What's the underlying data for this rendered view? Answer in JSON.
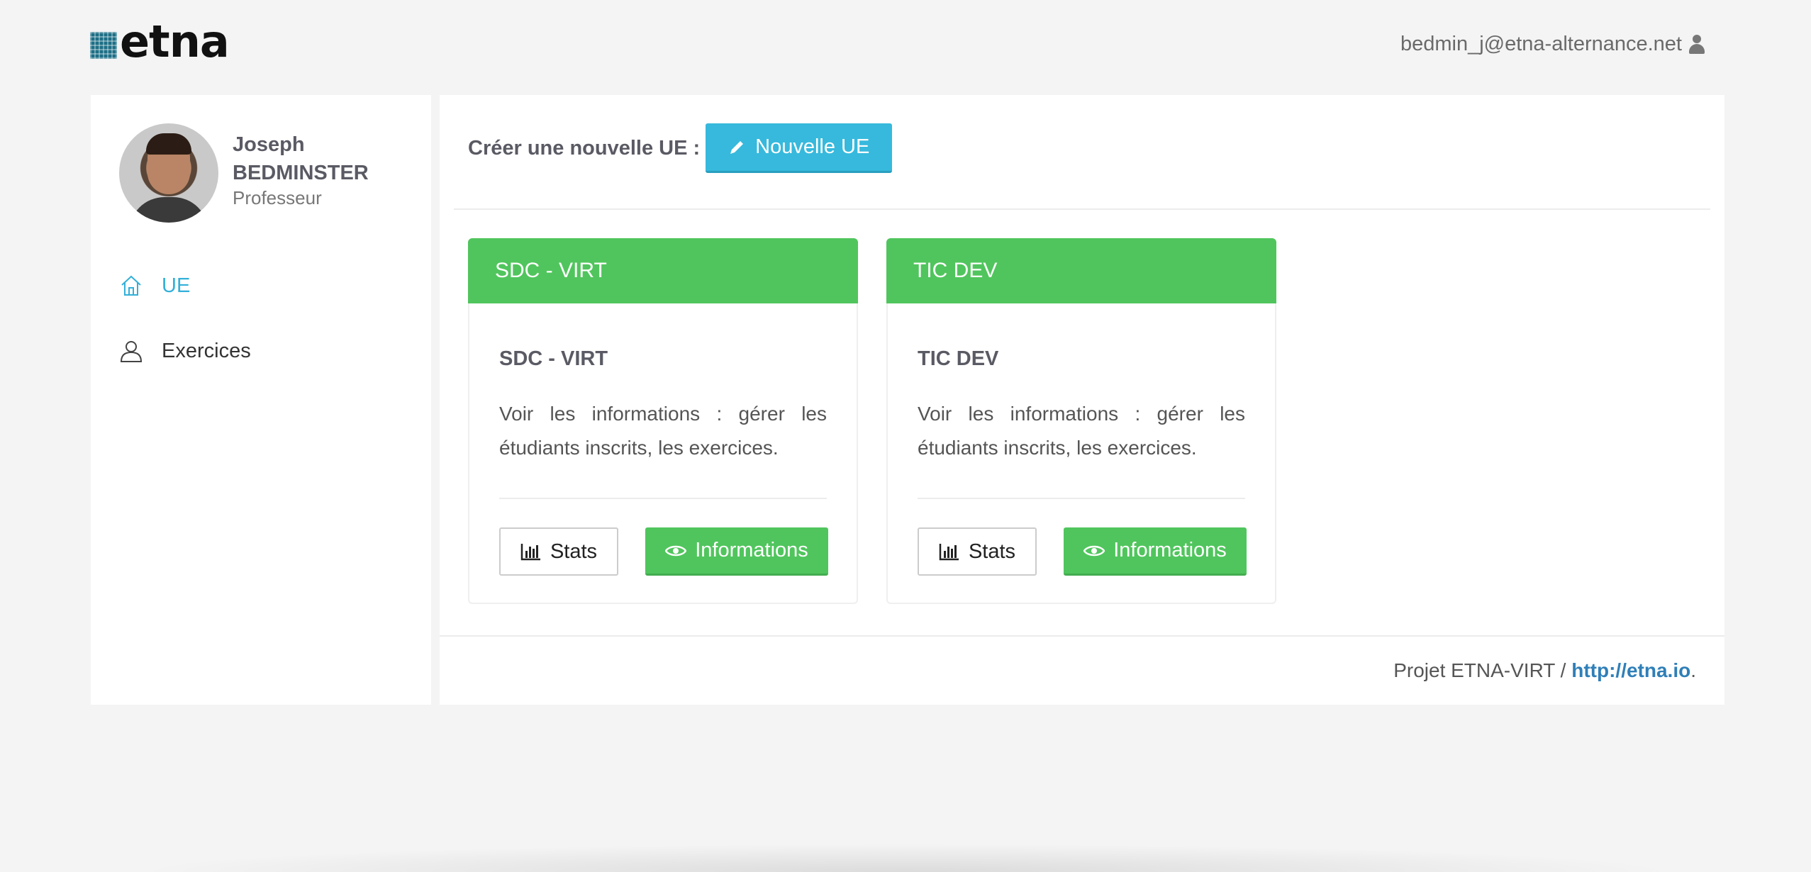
{
  "header": {
    "logo_text": "etna",
    "user_email": "bedmin_j@etna-alternance.net"
  },
  "sidebar": {
    "profile": {
      "first_name": "Joseph",
      "last_name": "BEDMINSTER",
      "role": "Professeur"
    },
    "nav": [
      {
        "label": "UE",
        "icon": "home-icon",
        "active": true
      },
      {
        "label": "Exercices",
        "icon": "user-icon",
        "active": false
      }
    ]
  },
  "main": {
    "create_label": "Créer une nouvelle UE :",
    "new_button_label": "Nouvelle UE",
    "cards": [
      {
        "header": "SDC - VIRT",
        "title": "SDC - VIRT",
        "description": "Voir les informations : gérer les étudiants inscrits, les exercices.",
        "stats_label": "Stats",
        "info_label": "Informations"
      },
      {
        "header": "TIC DEV",
        "title": "TIC DEV",
        "description": "Voir les informations : gérer les étudiants inscrits, les exercices.",
        "stats_label": "Stats",
        "info_label": "Informations"
      }
    ]
  },
  "footer": {
    "text": "Projet ETNA-VIRT / ",
    "link_text": "http://etna.io",
    "suffix": "."
  },
  "colors": {
    "accent_blue": "#36b9dc",
    "accent_green": "#50c55d",
    "link_blue": "#2f7fb8"
  }
}
